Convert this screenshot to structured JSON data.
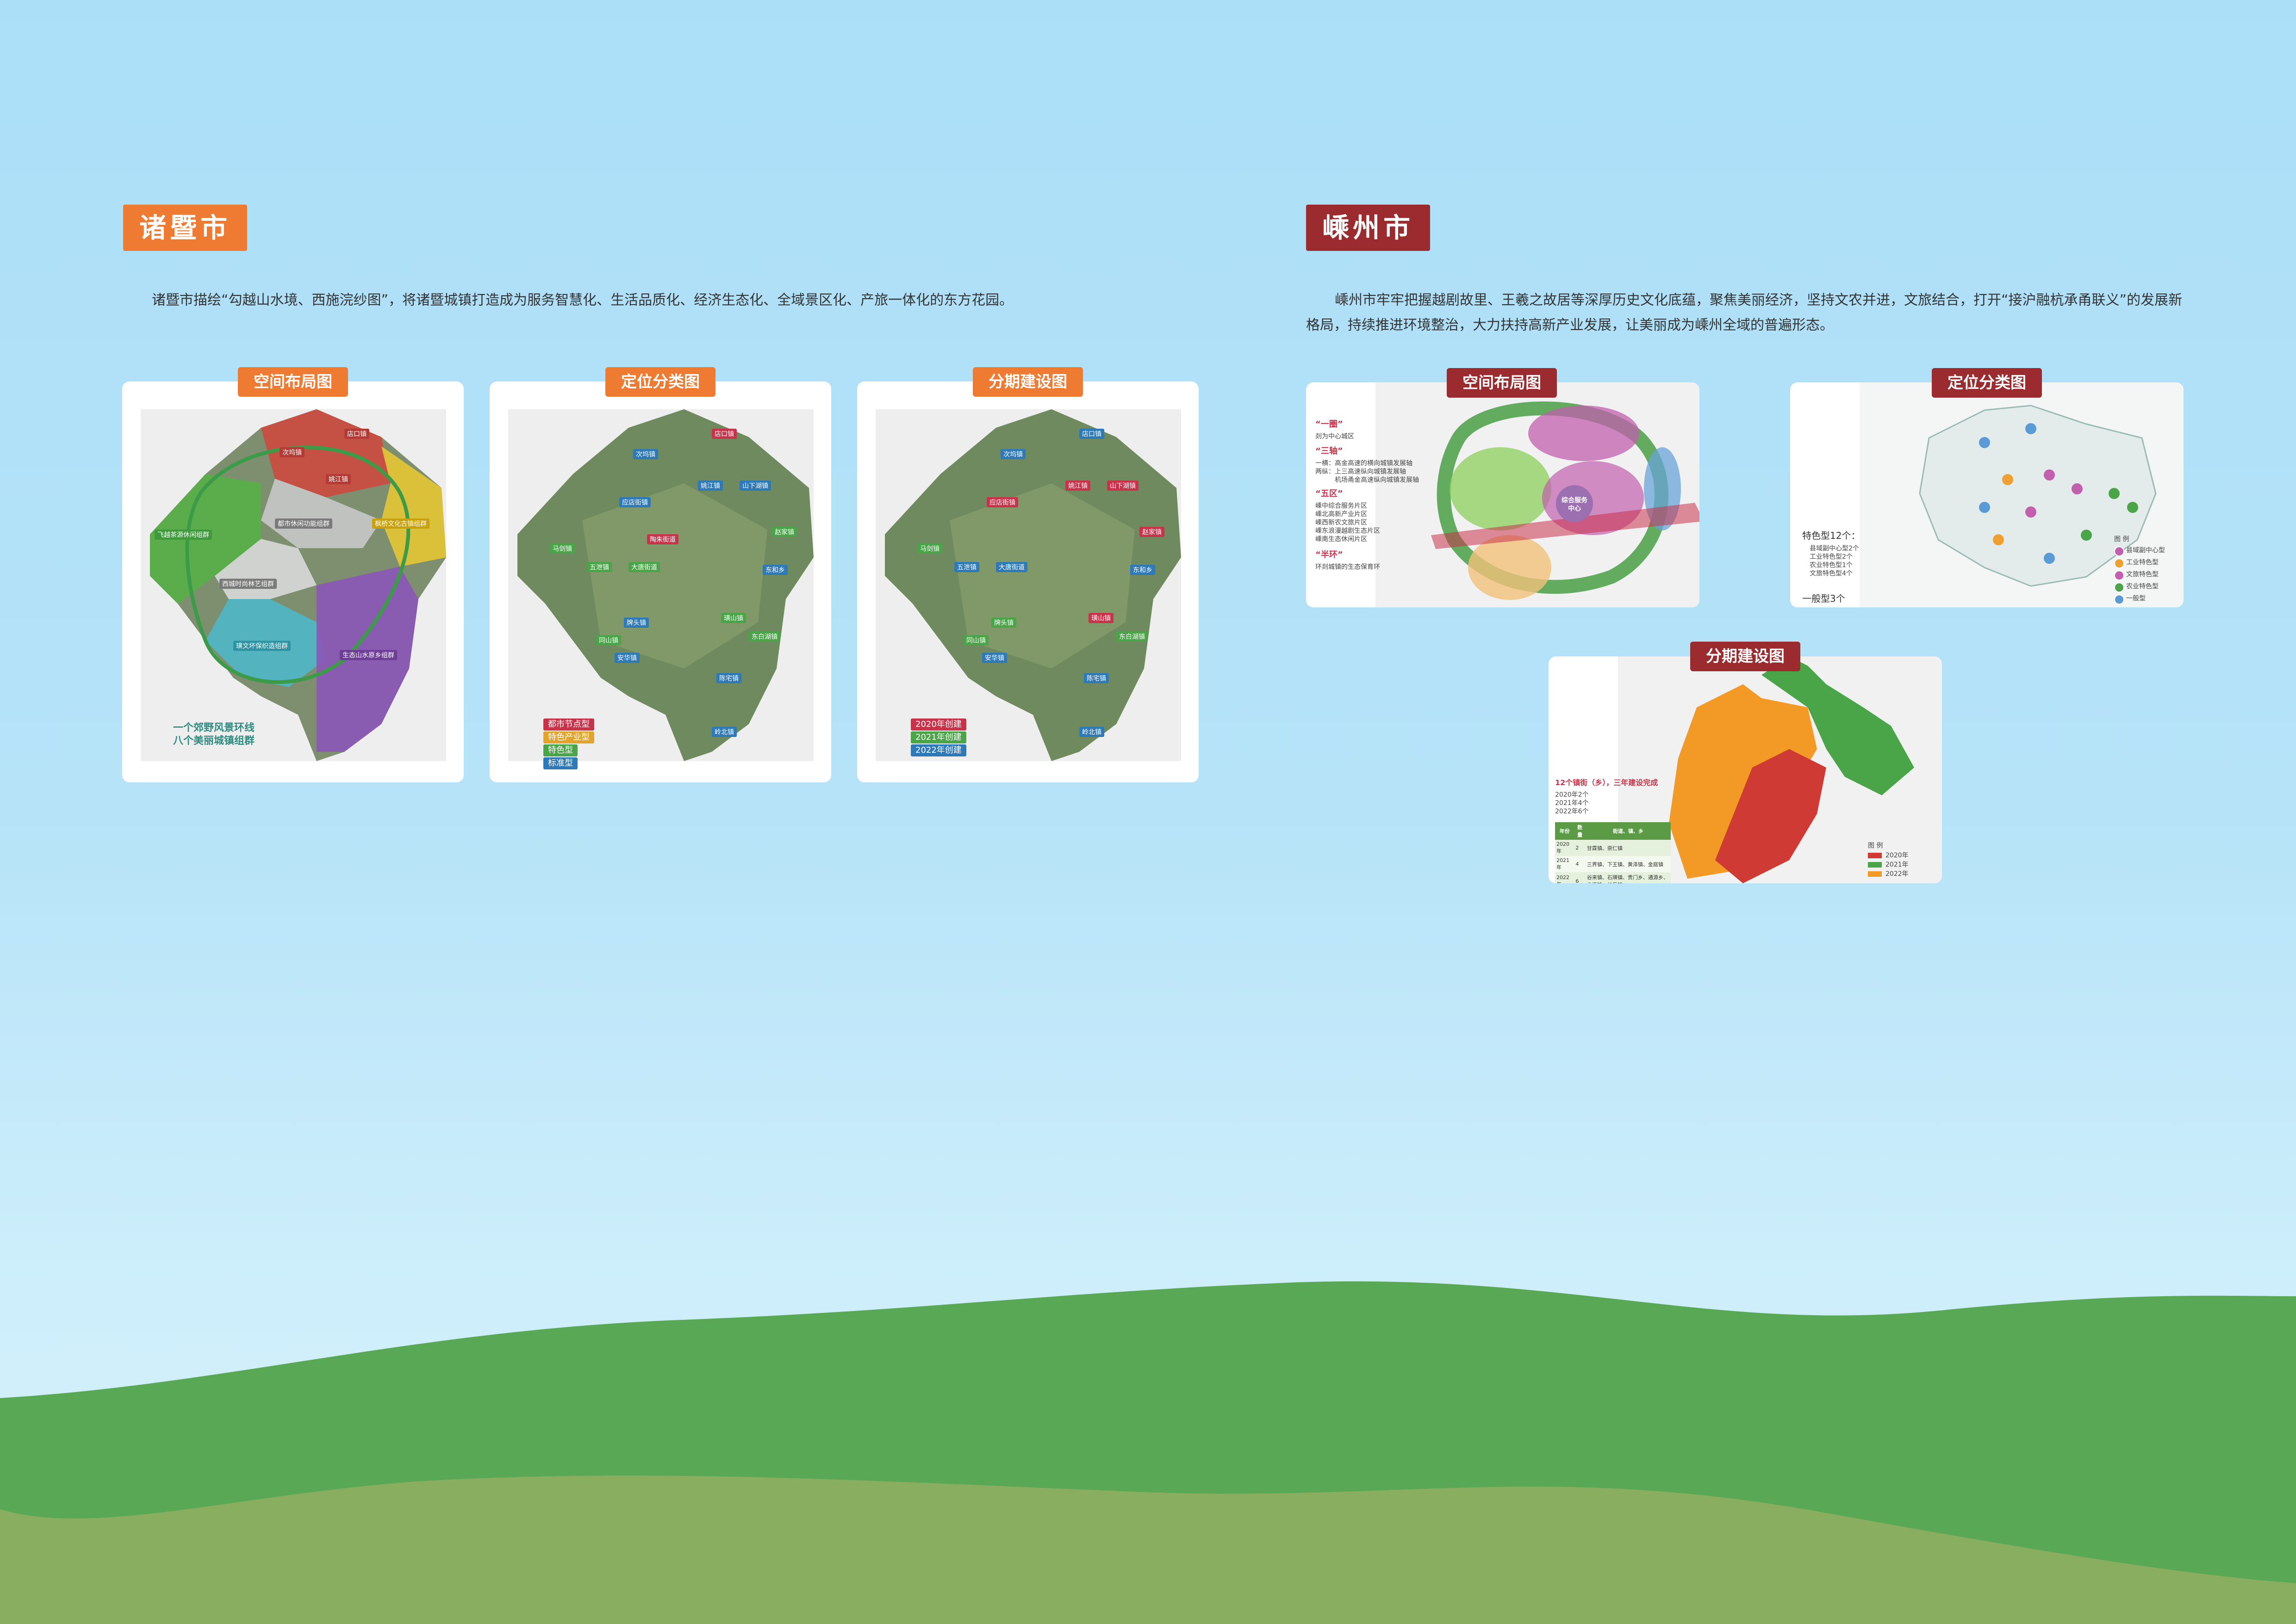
{
  "left": {
    "city": "诸暨市",
    "intro": "诸暨市描绘“勾越山水境、西施浣纱图”，将诸暨城镇打造成为服务智慧化、生活品质化、经济生态化、全域景区化、产旅一体化的东方花园。",
    "cards": [
      {
        "label": "空间布局图",
        "caption_line1": "一个郊野风景环线",
        "caption_line2": "八个美丽城镇组群"
      },
      {
        "label": "定位分类图",
        "legend": [
          "都市节点型",
          "特色产业型",
          "特色型",
          "标准型"
        ]
      },
      {
        "label": "分期建设图",
        "legend": [
          "2020年创建",
          "2021年创建",
          "2022年创建"
        ]
      }
    ],
    "card1_pins": [
      "店口镇",
      "次坞镇",
      "姚江镇",
      "枫桥文化古镇组群",
      "飞越茶源休闲组群",
      "都市休闲功能组群",
      "西城时尚林艺组群",
      "生态山水原乡组群",
      "璜文坏保织造组群"
    ],
    "card2_pins": [
      "店口镇",
      "次坞镇",
      "姚江镇",
      "山下湖镇",
      "应店街镇",
      "马剑镇",
      "五泄镇",
      "大唐街道",
      "陶朱街道",
      "东和乡",
      "赵家镇",
      "璜山镇",
      "牌头镇",
      "同山镇",
      "安华镇",
      "东白湖镇",
      "陈宅镇",
      "岭北镇"
    ],
    "card3_pins": [
      "店口镇",
      "次坞镇",
      "姚江镇",
      "山下湖镇",
      "应店街镇",
      "马剑镇",
      "五泄镇",
      "大唐街道",
      "东和乡",
      "赵家镇",
      "璜山镇",
      "牌头镇",
      "同山镇",
      "安华镇",
      "东白湖镇",
      "陈宅镇",
      "岭北镇"
    ]
  },
  "right": {
    "city": "嵊州市",
    "intro_line1": "嵊州市牢牢把握越剧故里、王羲之故居等深厚历史文化底蕴，聚焦美丽经济，坚持文农并进，文旅结合，打开“接沪融杭承甬联义”的发展新",
    "intro_line2": "格局，持续推进环境整治，大力扶持高新产业发展，让美丽成为嵊州全域的普遍形态。",
    "cards": [
      {
        "label": "空间布局图",
        "notes": [
          "“一圈”",
          "剡为中心城区",
          "“三轴”",
          "一横：高金高速的横向城镇发展轴",
          "两纵：上三高速纵向城镇发展轴",
          "　　　机场甬金高速纵向城镇发展轴",
          "“五区”",
          "嵊中综合服务片区",
          "嵊北高新产业片区",
          "嵊西新农文旅片区",
          "嵊东浪漫越剧生态片区",
          "嵊南生态休闲片区",
          "“半环”",
          "环剡城镇的生态保育环"
        ],
        "center": "综合服务中心"
      },
      {
        "label": "定位分类图",
        "summary": "特色型12个：",
        "items": [
          "县域副中心型2个",
          "工业特色型2个",
          "农业特色型1个",
          "文旅特色型4个"
        ],
        "footer": "一般型3个",
        "legend_title": "图 例",
        "legend": [
          "县域副中心型",
          "工业特色型",
          "文旅特色型",
          "农业特色型",
          "一般型"
        ]
      },
      {
        "label": "分期建设图",
        "headline": "12个镇街（乡），三年建设完成",
        "lines": [
          "2020年2个",
          "2021年4个",
          "2022年6个"
        ],
        "table_header": [
          "年份",
          "数量",
          "街道、镇、乡"
        ],
        "table_rows": [
          [
            "2020年",
            "2",
            "甘霖镇、崇仁镇"
          ],
          [
            "2021年",
            "4",
            "三界镇、下王镇、黄泽镇、金庭镇"
          ],
          [
            "2022年",
            "6",
            "谷来镇、石璜镇、贵门乡、通源乡、北漳镇、长乐镇"
          ]
        ],
        "legend_title": "图 例",
        "legend": [
          "2020年",
          "2021年",
          "2022年"
        ]
      }
    ]
  },
  "colors": {
    "orange": "#ef7a32",
    "maroon": "#9b2b2e",
    "green_hill": "#58a855",
    "olive_hill": "#8aae5f"
  }
}
